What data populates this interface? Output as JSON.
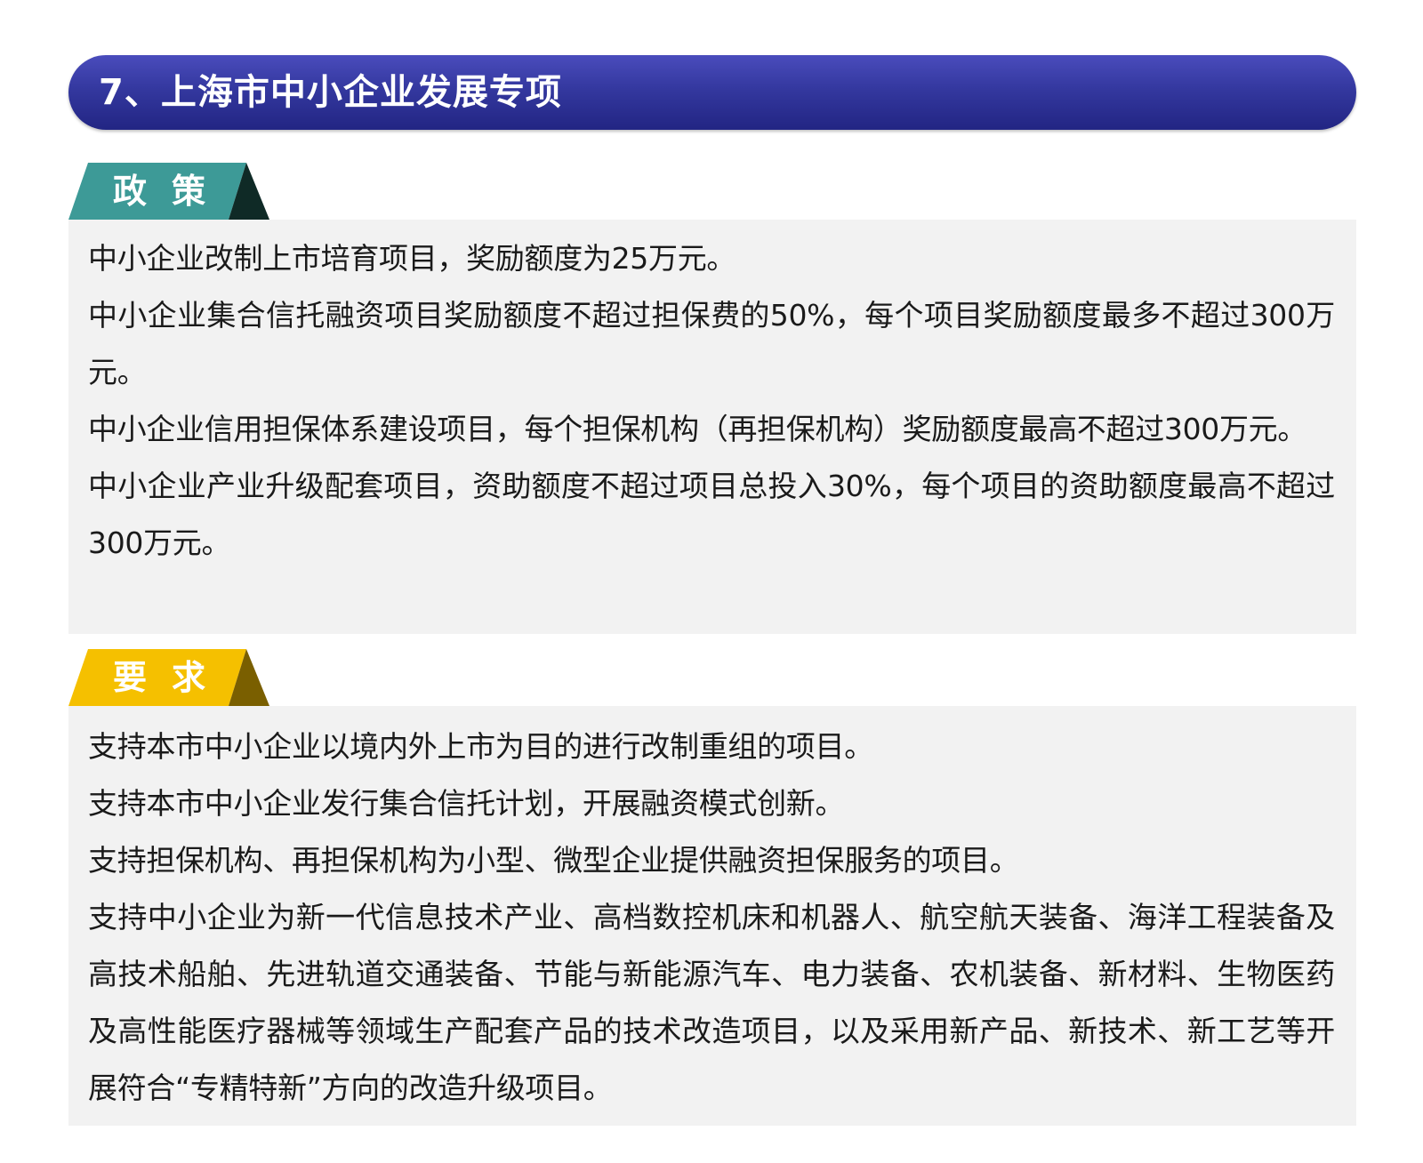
{
  "title": "7、上海市中小企业发展专项",
  "colors": {
    "title_bar": "#2f3399",
    "policy_tab": "#3d9a97",
    "policy_tab_dark": "#0f2a26",
    "requirement_tab": "#f5c000",
    "requirement_tab_dark": "#7a5f00",
    "panel_bg": "#f2f2f2"
  },
  "policy": {
    "label": "政策",
    "items": [
      "中小企业改制上市培育项目，奖励额度为25万元。",
      "中小企业集合信托融资项目奖励额度不超过担保费的50%，每个项目奖励额度最多不超过300万元。",
      "中小企业信用担保体系建设项目，每个担保机构（再担保机构）奖励额度最高不超过300万元。",
      "中小企业产业升级配套项目，资助额度不超过项目总投入30%，每个项目的资助额度最高不超过300万元。"
    ]
  },
  "requirements": {
    "label": "要求",
    "items": [
      "支持本市中小企业以境内外上市为目的进行改制重组的项目。",
      "支持本市中小企业发行集合信托计划，开展融资模式创新。",
      "支持担保机构、再担保机构为小型、微型企业提供融资担保服务的项目。",
      "支持中小企业为新一代信息技术产业、高档数控机床和机器人、航空航天装备、海洋工程装备及高技术船舶、先进轨道交通装备、节能与新能源汽车、电力装备、农机装备、新材料、生物医药及高性能医疗器械等领域生产配套产品的技术改造项目，以及采用新产品、新技术、新工艺等开展符合“专精特新”方向的改造升级项目。"
    ]
  }
}
